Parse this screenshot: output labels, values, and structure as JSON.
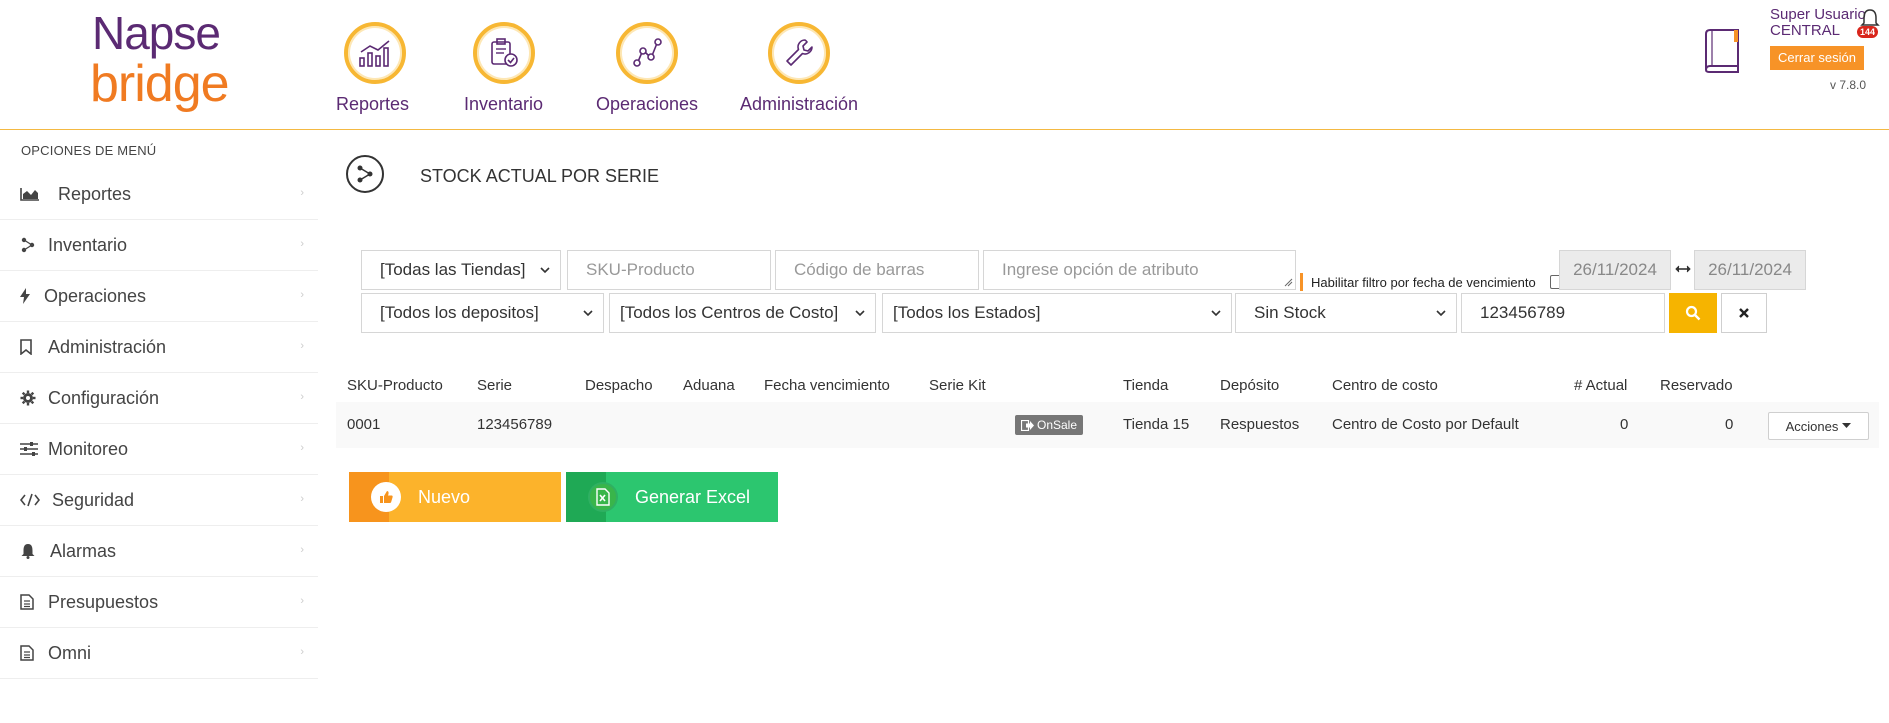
{
  "brand": {
    "line1": "Napse",
    "line2": "bridge"
  },
  "topnav": [
    {
      "label": "Reportes"
    },
    {
      "label": "Inventario"
    },
    {
      "label": "Operaciones"
    },
    {
      "label": "Administración"
    }
  ],
  "user": {
    "name": "Super Usuario",
    "org": "CENTRAL",
    "logout_label": "Cerrar sesión",
    "version": "v 7.8.0",
    "notifications": "144"
  },
  "sidebar": {
    "title": "OPCIONES DE MENÚ",
    "items": [
      {
        "label": "Reportes"
      },
      {
        "label": "Inventario"
      },
      {
        "label": "Operaciones"
      },
      {
        "label": "Administración"
      },
      {
        "label": "Configuración"
      },
      {
        "label": "Monitoreo"
      },
      {
        "label": "Seguridad"
      },
      {
        "label": "Alarmas"
      },
      {
        "label": "Presupuestos"
      },
      {
        "label": "Omni"
      }
    ]
  },
  "page": {
    "title": "STOCK ACTUAL POR SERIE"
  },
  "filters": {
    "tiendas": "[Todas las Tiendas]",
    "sku_placeholder": "SKU-Producto",
    "barcode_placeholder": "Código de barras",
    "atributo_placeholder": "Ingrese opción de atributo",
    "vencimiento_label": "Habilitar filtro por fecha de vencimiento",
    "fecha_desde": "26/11/2024",
    "fecha_hasta": "26/11/2024",
    "depositos": "[Todos los depositos]",
    "centros_costo": "[Todos los Centros de Costo]",
    "estados": "[Todos los Estados]",
    "stock": "Sin Stock",
    "serie_value": "123456789"
  },
  "table": {
    "columns": [
      "SKU-Producto",
      "Serie",
      "Despacho",
      "Aduana",
      "Fecha vencimiento",
      "Serie Kit",
      "Tienda",
      "Depósito",
      "Centro de costo",
      "# Actual",
      "Reservado"
    ],
    "rows": [
      {
        "sku": "0001",
        "serie": "123456789",
        "despacho": "",
        "aduana": "",
        "fecha": "",
        "serie_kit": "",
        "badge": "OnSale",
        "tienda": "Tienda 15",
        "deposito": "Respuestos",
        "centro": "Centro de Costo por Default",
        "actual": "0",
        "reservado": "0",
        "acciones": "Acciones"
      }
    ]
  },
  "actions": {
    "nuevo": "Nuevo",
    "excel": "Generar Excel"
  },
  "colors": {
    "accent": "#f6b400",
    "brand_purple": "#5b2a73",
    "brand_orange": "#f07b22",
    "excel_green": "#2cc66f"
  }
}
